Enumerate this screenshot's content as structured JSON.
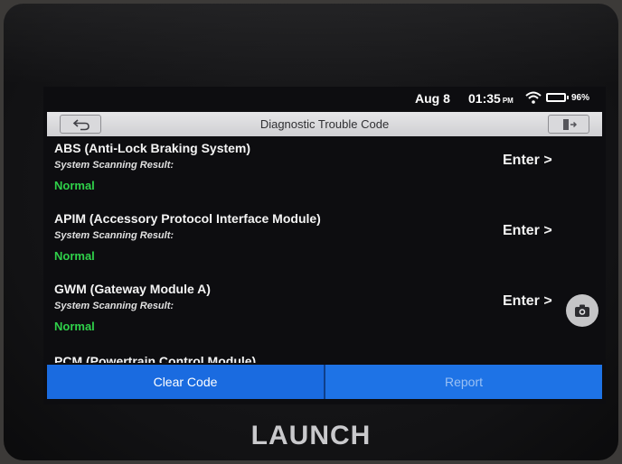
{
  "statusbar": {
    "date": "Aug 8",
    "time": "01:35",
    "ampm": "PM",
    "battery": "96%",
    "icons": [
      "wifi-icon",
      "battery-icon"
    ]
  },
  "titlebar": {
    "title": "Diagnostic Trouble Code",
    "back_icon": "back-arrow-icon",
    "exit_icon": "exit-door-icon"
  },
  "modules": [
    {
      "name": "ABS (Anti-Lock Braking System)",
      "scan_label": "System Scanning Result:",
      "result": "Normal",
      "action": "Enter >"
    },
    {
      "name": "APIM (Accessory Protocol Interface Module)",
      "scan_label": "System Scanning Result:",
      "result": "Normal",
      "action": "Enter >"
    },
    {
      "name": "GWM (Gateway Module A)",
      "scan_label": "System Scanning Result:",
      "result": "Normal",
      "action": "Enter >"
    },
    {
      "name": "PCM (Powertrain Control Module)",
      "scan_label": "",
      "result": "",
      "action": ""
    }
  ],
  "bottombar": {
    "clear_code": "Clear Code",
    "report": "Report"
  },
  "floating": {
    "camera_icon": "camera-icon"
  },
  "device": {
    "logo": "LAUNCH"
  },
  "colors": {
    "normal": "#2fd14a",
    "accent": "#1a6ee0",
    "titlebar": "#d9d9dc"
  }
}
